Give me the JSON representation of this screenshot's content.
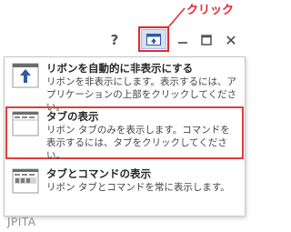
{
  "annotation": {
    "click_label": "クリック"
  },
  "titlebar": {
    "help_label": "?",
    "close_label": "✕",
    "accent": "#e8262e"
  },
  "menu": {
    "items": [
      {
        "icon": "auto-hide-ribbon-icon",
        "title": "リボンを自動的に非表示にする",
        "desc": "リボンを非表示にします。表示するには、アプリケーションの上部をクリックしてください。"
      },
      {
        "icon": "show-tabs-icon",
        "title": "タブの表示",
        "desc": "リボン タブのみを表示します。コマンドを表示するには、タブをクリックしてください。",
        "selected": true
      },
      {
        "icon": "show-tabs-and-commands-icon",
        "title": "タブとコマンドの表示",
        "desc": "リボン タブとコマンドを常に表示します。"
      }
    ]
  },
  "watermark": "JPITA"
}
